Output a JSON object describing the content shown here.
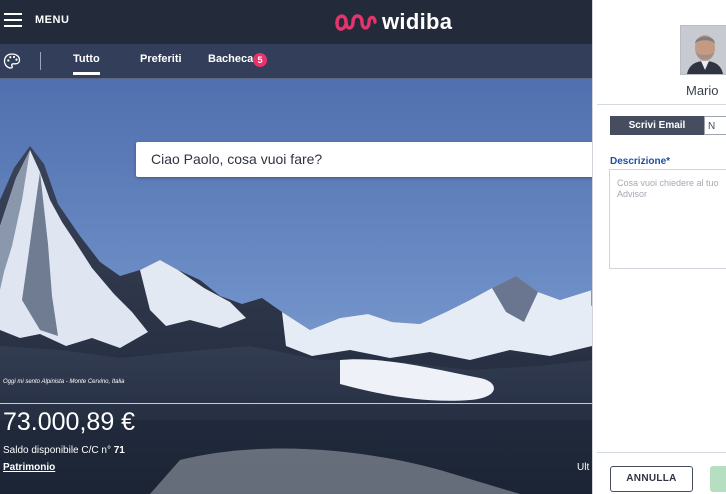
{
  "header": {
    "menu_label": "MENU",
    "brand": "widiba",
    "brand_color": "#e6336b"
  },
  "tabs": [
    {
      "label": "Tutto",
      "active": true
    },
    {
      "label": "Preferiti",
      "active": false
    },
    {
      "label": "Bacheca",
      "active": false,
      "badge": "5"
    }
  ],
  "hero": {
    "search_prompt": "Ciao Paolo, cosa vuoi fare?",
    "photo_caption": "Oggi mi sento Alpinista - Monte Cervino, Italia",
    "balance": "73.000,89 €",
    "account_label": "Saldo disponibile C/C n°",
    "account_number": "71",
    "patrimonio_link": "Patrimonio",
    "cut_link": "Ult"
  },
  "advisor_panel": {
    "advisor_name": "Mario",
    "tabs": [
      "Scrivi Email",
      "N"
    ],
    "description_label": "Descrizione*",
    "description_placeholder": "Cosa vuoi chiedere al tuo Advisor",
    "cancel_label": "ANNULLA",
    "confirm_color": "#b5dfc0"
  }
}
